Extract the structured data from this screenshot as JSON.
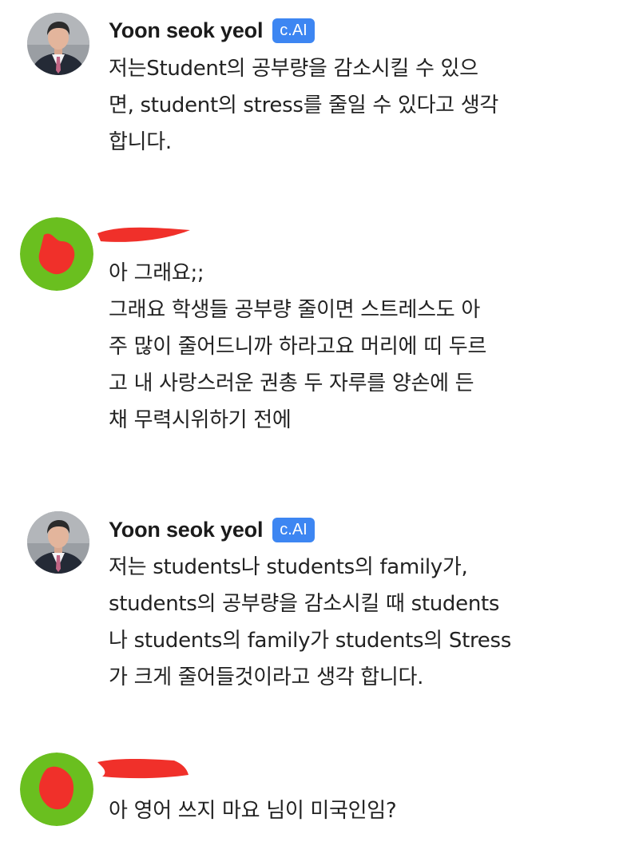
{
  "messages": [
    {
      "sender": "Yoon seok yeol",
      "badge": "c.AI",
      "text": "저는Student의 공부량을 감소시킬 수 있으\n면, student의 stress를 줄일 수 있다고 생각\n합니다.",
      "avatar": "person-portrait"
    },
    {
      "sender": "",
      "text": "아 그래요;;\n그래요 학생들 공부량 줄이면 스트레스도 아\n주 많이 줄어드니까 하라고요 머리에 띠 두르\n고 내 사랑스러운 권총 두 자루를 양손에 든\n채 무력시위하기 전에",
      "avatar": "green-avatar-redacted"
    },
    {
      "sender": "Yoon seok yeol",
      "badge": "c.AI",
      "text": "저는 students나 students의 family가,\nstudents의 공부량을 감소시킬 때 students\n나 students의 family가 students의 Stress\n가 크게 줄어들것이라고 생각 합니다.",
      "avatar": "person-portrait"
    },
    {
      "sender": "",
      "text": "아 영어 쓰지 마요 님이 미국인임?",
      "avatar": "green-avatar-redacted"
    }
  ],
  "colors": {
    "badge": "#3d86f2",
    "user_avatar": "#6abf1f",
    "redaction": "#f0302a"
  }
}
